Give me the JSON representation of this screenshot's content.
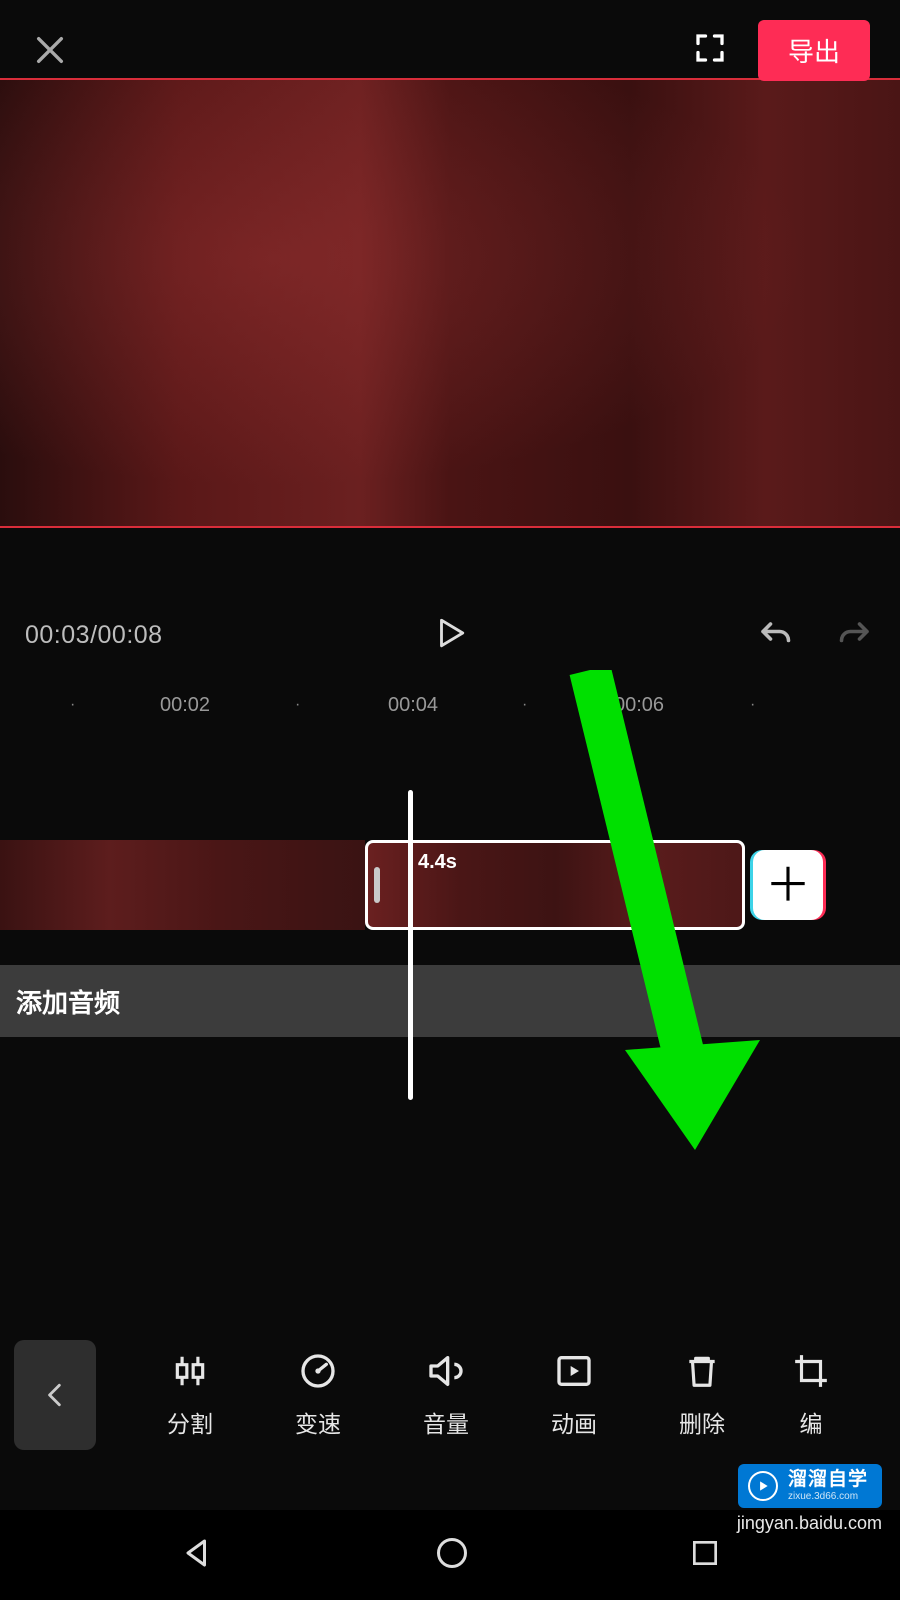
{
  "top": {
    "export_label": "导出"
  },
  "playback": {
    "current_time": "00:03",
    "total_time": "00:08"
  },
  "ruler": {
    "ticks": [
      "00:02",
      "00:04",
      "00:06"
    ]
  },
  "timeline": {
    "selected_clip_duration": "4.4s",
    "add_audio_label": "添加音频"
  },
  "tools": {
    "split": "分割",
    "speed": "变速",
    "volume": "音量",
    "animation": "动画",
    "delete": "删除",
    "edit": "编"
  },
  "watermark": {
    "text": "溜溜自学",
    "sub": "zixue.3d66.com",
    "site": "jingyan.baidu.com"
  }
}
